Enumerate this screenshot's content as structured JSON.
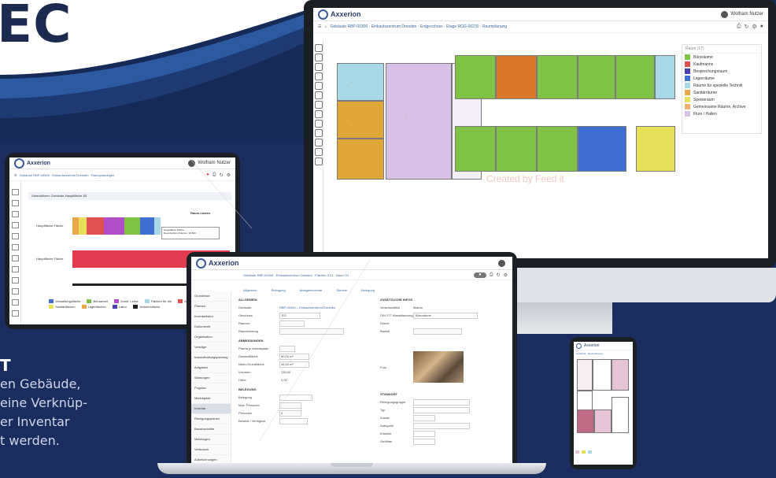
{
  "hero": {
    "title": "EC",
    "sidebar_heading": "T",
    "sidebar_lines": [
      "en Gebäude,",
      "eine Verknüp-",
      "er Inventar",
      "t werden."
    ]
  },
  "brand": {
    "app_name": "Axxerion"
  },
  "monitor": {
    "user_name": "Wolfram Nutzer",
    "breadcrumb": "Gebäude RBP-00300 · Einkaufszentrum Dresden · Erdgeschoss · Etage RGG-00230 · Raumplanung",
    "legend_header": "Raum (17)",
    "legend": [
      {
        "label": "Büroräume",
        "color": "#7fc246"
      },
      {
        "label": "Kaufmanns",
        "color": "#e05252"
      },
      {
        "label": "Besprechungsraum",
        "color": "#4b3fb4"
      },
      {
        "label": "Lagerräume",
        "color": "#3f6fd1"
      },
      {
        "label": "Räume für spezielle Technik",
        "color": "#a9d9e6"
      },
      {
        "label": "Sanitärräume",
        "color": "#e9a84a"
      },
      {
        "label": "Speiseraum",
        "color": "#e6e05a"
      },
      {
        "label": "Gemeinsame Räume, Archive",
        "color": "#f0b06e"
      },
      {
        "label": "Flure / Hallen",
        "color": "#d8c1e6"
      }
    ],
    "watermark": "Created by Feed it",
    "colors": {
      "green": "#7fc246",
      "orange": "#d9782a",
      "lilac": "#d8c1e6",
      "ochre": "#e0a63a",
      "blue": "#3f6fd1",
      "yellow": "#e6e05a",
      "cyan": "#a9d9e6"
    }
  },
  "tablet": {
    "breadcrumb": "Gebäude RBP-00300 · Einkaufszentrum Dresden · Raumplanungen",
    "panel_title": "Unterstützen: Gebäude-Hauptfläche 1B",
    "user_name": "Wolfram Nutzer",
    "chart_label": "Raum-Lasten",
    "category_top": "Hauptfläche Fläche",
    "category_bottom": "Hauptfläche Fläche",
    "tooltip_line1": "Hauptfläche Fläche",
    "tooltip_line2": "Raumfunktion Flächen: 18,500",
    "legend": [
      "Verwaltungsfläche",
      "Büroarbeit",
      "Sonst. Lehre",
      "Flächen für die",
      "Ausstellungsfläche",
      "Sanitärflächen",
      "Lagerflächen",
      "Labor",
      "Verkehrsfläche"
    ]
  },
  "laptop": {
    "breadcrumb": "Gebäude RBP-00300 · Einkaufszentrum Dresden · Flächen 2.01 · Raum 01",
    "tabs": [
      "Allgemein",
      "Reinigung",
      "Anlageninventar",
      "Dienste",
      "Belegung"
    ],
    "sidebar": [
      "Grundrisse",
      "Flächen",
      "Inventarlisten",
      "Dokumente",
      "Organisation",
      "Verträge",
      "Instandhaltungsplanung",
      "Aufgaben",
      "Wartungen",
      "Projekte",
      "Mietobjekte",
      "Inventar",
      "Reinigungsplanen",
      "Bauabschnitte",
      "Meldungen",
      "Verbrauch",
      "Aufzeichnungen"
    ],
    "sidebar_selected": 11,
    "section_general": "ALLGEMEIN",
    "section_dimensions": "ABMESSUNGEN",
    "section_belegung": "BELEGUNG",
    "section_extra": "ZUSÄTZLICHE INFOS",
    "section_lage": "STANDORT",
    "fields_left": [
      "Gebäude",
      "Geschoss",
      "Raumnr.",
      "Raumnutzung",
      "Fläche je Arbeitsplatz",
      "Gesamtfläche",
      "Netto-Grundfläche",
      "Volumen",
      "Höhe",
      "Belegung",
      "Max. Personen",
      "Personen",
      "Besetzt / Verfügbar"
    ],
    "fields_right": [
      "Verantwortlich",
      "DIN 277 Klassifizierung",
      "Ebene",
      "Bauteil",
      "Foto",
      "Reinigungsgruppe",
      "Typ",
      "Zusatz",
      "Kategorie",
      "Ersteller",
      "Geöffnet"
    ],
    "values": {
      "building": "RBP-00300 – Einkaufszentrum Dresden",
      "floor": "EG",
      "area": "50,00 m²",
      "net": "45,00 m²",
      "volume": "135,00",
      "height": "3,00",
      "people": "2",
      "manager": "Malmo",
      "din": "Büroräume"
    }
  },
  "phone": {
    "app_name": "Axxerion",
    "breadcrumb": "Gebäude · Raumplanung"
  }
}
